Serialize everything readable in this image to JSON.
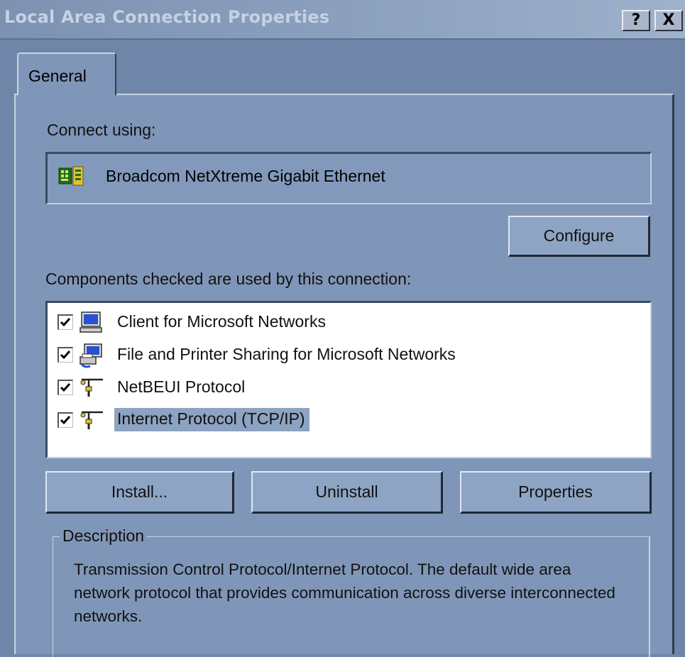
{
  "window": {
    "title": "Local Area Connection Properties",
    "help_label": "?",
    "close_label": "X"
  },
  "tab": {
    "label": "General"
  },
  "connect_using": {
    "label": "Connect using:",
    "adapter_name": "Broadcom NetXtreme Gigabit Ethernet",
    "adapter_icon": "network-card-icon"
  },
  "configure_label": "Configure",
  "components": {
    "label": "Components checked are used by this connection:",
    "items": [
      {
        "label": "Client for Microsoft Networks",
        "checked": true,
        "icon": "client-computer-icon",
        "selected": false
      },
      {
        "label": "File and Printer Sharing for Microsoft Networks",
        "checked": true,
        "icon": "printer-sharing-icon",
        "selected": false
      },
      {
        "label": "NetBEUI Protocol",
        "checked": true,
        "icon": "protocol-icon",
        "selected": false
      },
      {
        "label": "Internet Protocol (TCP/IP)",
        "checked": true,
        "icon": "protocol-icon",
        "selected": true
      }
    ]
  },
  "buttons": {
    "install": "Install...",
    "uninstall": "Uninstall",
    "properties": "Properties"
  },
  "description": {
    "title": "Description",
    "text": "Transmission Control Protocol/Internet Protocol. The default wide area network protocol that provides communication across diverse interconnected networks."
  },
  "colors": {
    "dialog_face": "#7f96b8",
    "selection": "#8da3c2",
    "title_text": "#c6d2e3"
  }
}
